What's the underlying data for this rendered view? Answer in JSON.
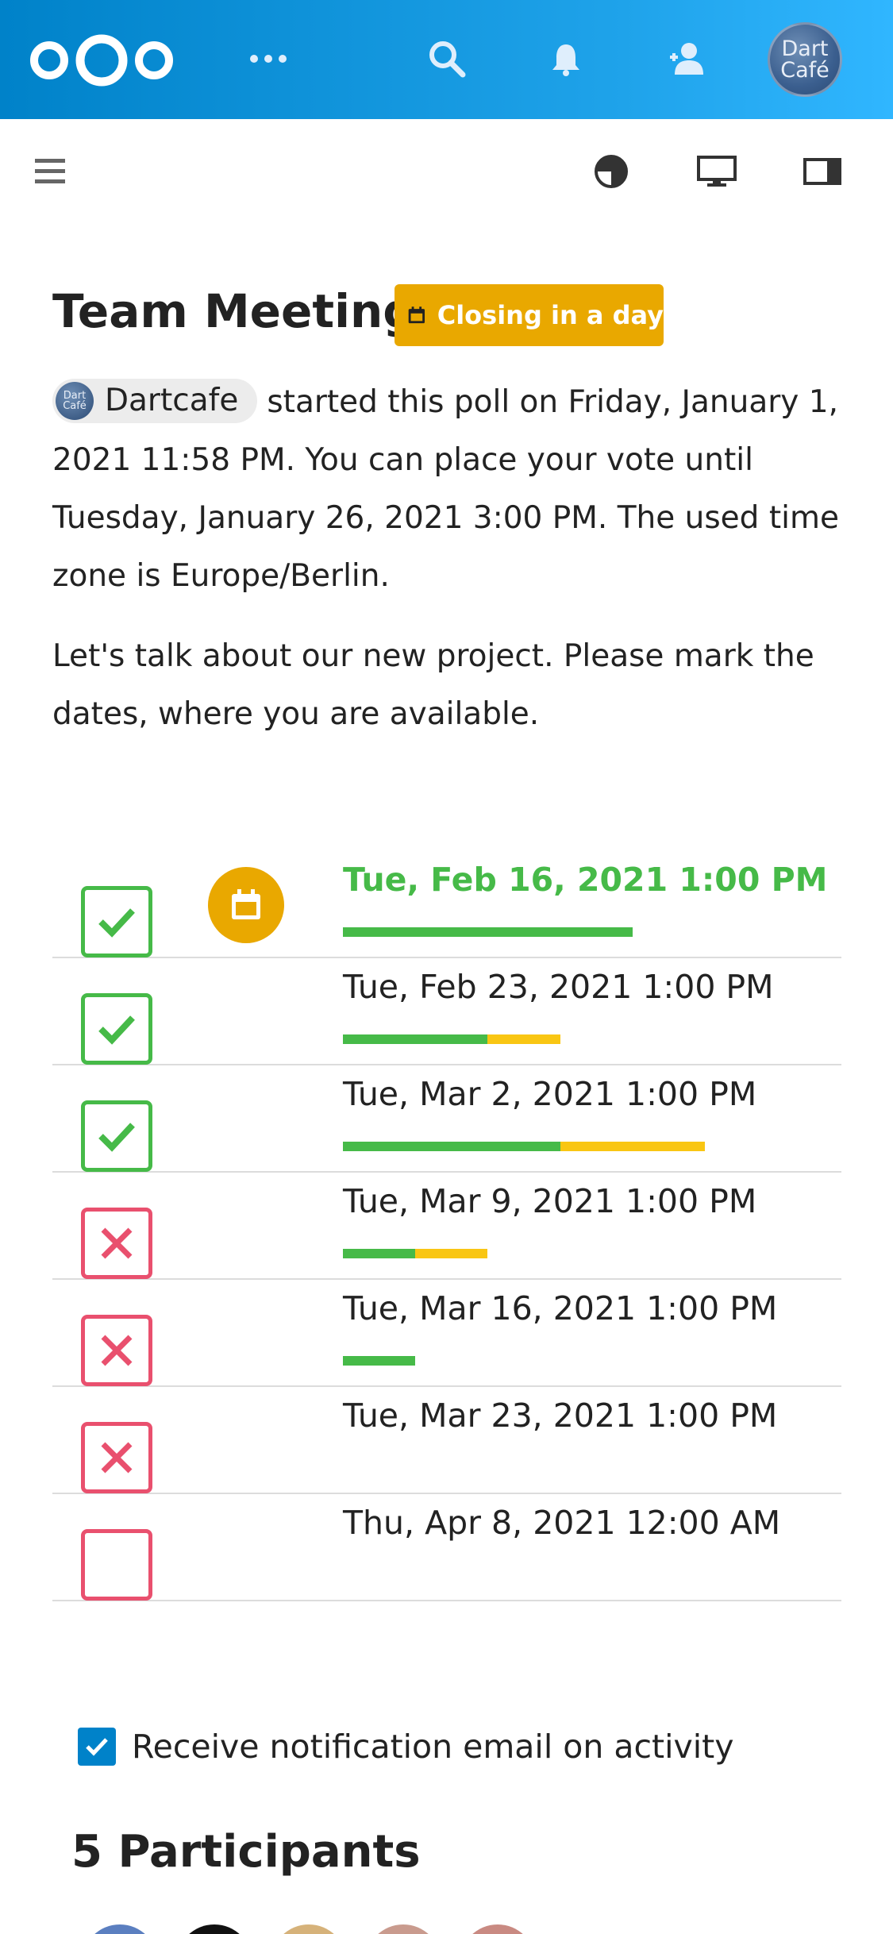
{
  "header": {
    "logo": "nextcloud-logo",
    "icons": [
      "apps-more-icon",
      "search-icon",
      "notifications-bell-icon",
      "contacts-icon"
    ],
    "avatar_text": [
      "Dart",
      "Café"
    ]
  },
  "toolbar": {
    "icons": [
      "menu-icon",
      "theme-contrast-icon",
      "display-icon",
      "sidebar-toggle-icon"
    ]
  },
  "poll": {
    "title": "Team Meeting",
    "badge": "Closing in a day",
    "owner": "Dartcafe",
    "owner_avatar_text": [
      "Dart",
      "Café"
    ],
    "info": "started this poll on Friday, January 1, 2021 11:58 PM. You can place your vote until Tuesday, January 26, 2021 3:00 PM. The used time zone is Europe/Berlin.",
    "description": "Let's talk about our new project. Please mark the dates, where you are available."
  },
  "options": [
    {
      "label": "Tue, Feb 16, 2021 1:00 PM",
      "vote": "yes",
      "winner": true,
      "confirmed": true,
      "yes": 0.48,
      "maybe": 0
    },
    {
      "label": "Tue, Feb 23, 2021 1:00 PM",
      "vote": "yes",
      "winner": false,
      "confirmed": false,
      "yes": 0.24,
      "maybe": 0.12
    },
    {
      "label": "Tue, Mar 2, 2021 1:00 PM",
      "vote": "yes",
      "winner": false,
      "confirmed": false,
      "yes": 0.36,
      "maybe": 0.24
    },
    {
      "label": "Tue, Mar 9, 2021 1:00 PM",
      "vote": "no",
      "winner": false,
      "confirmed": false,
      "yes": 0.12,
      "maybe": 0.12
    },
    {
      "label": "Tue, Mar 16, 2021 1:00 PM",
      "vote": "no",
      "winner": false,
      "confirmed": false,
      "yes": 0.12,
      "maybe": 0
    },
    {
      "label": "Tue, Mar 23, 2021 1:00 PM",
      "vote": "no",
      "winner": false,
      "confirmed": false,
      "yes": 0,
      "maybe": 0
    },
    {
      "label": "Thu, Apr 8, 2021 12:00 AM",
      "vote": "none",
      "winner": false,
      "confirmed": false,
      "yes": 0,
      "maybe": 0
    }
  ],
  "notification": {
    "label": "Receive notification email on activity",
    "checked": true
  },
  "participants": {
    "heading": "5 Participants"
  },
  "colors": {
    "header": "#0082c9",
    "yes": "#46ba48",
    "no": "#e9506e",
    "maybe": "#f9c613",
    "badge": "#e9a800"
  }
}
